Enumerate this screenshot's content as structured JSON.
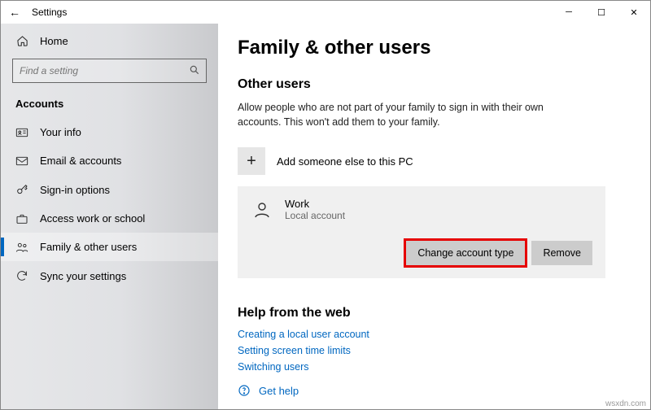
{
  "titlebar": {
    "back": "←",
    "title": "Settings"
  },
  "sidebar": {
    "home": "Home",
    "search_placeholder": "Find a setting",
    "section": "Accounts",
    "items": [
      {
        "label": "Your info"
      },
      {
        "label": "Email & accounts"
      },
      {
        "label": "Sign-in options"
      },
      {
        "label": "Access work or school"
      },
      {
        "label": "Family & other users"
      },
      {
        "label": "Sync your settings"
      }
    ]
  },
  "content": {
    "heading": "Family & other users",
    "other_users_heading": "Other users",
    "other_users_desc": "Allow people who are not part of your family to sign in with their own accounts. This won't add them to your family.",
    "add_label": "Add someone else to this PC",
    "user": {
      "name": "Work",
      "sub": "Local account"
    },
    "change_btn": "Change account type",
    "remove_btn": "Remove",
    "help_heading": "Help from the web",
    "help_links": [
      "Creating a local user account",
      "Setting screen time limits",
      "Switching users"
    ],
    "get_help": "Get help"
  },
  "watermark": "wsxdn.com"
}
